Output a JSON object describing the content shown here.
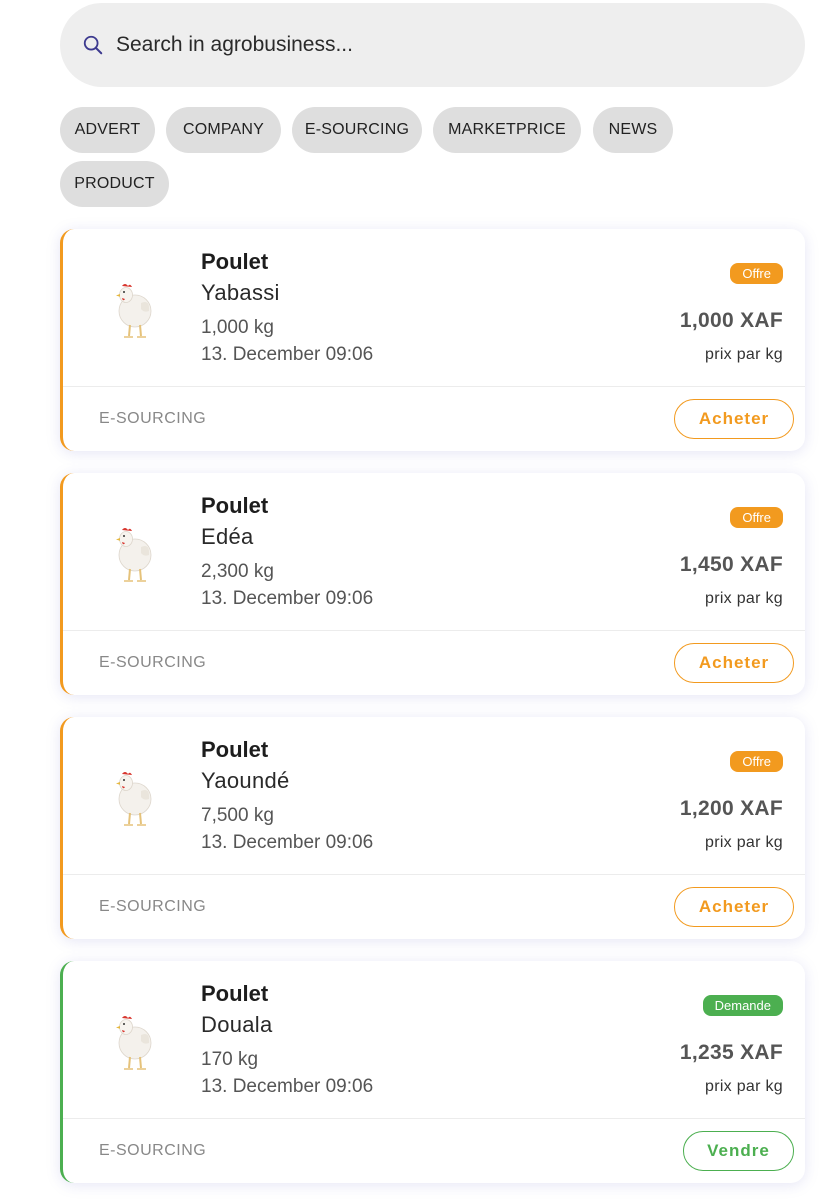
{
  "search": {
    "placeholder": "Search in agrobusiness...",
    "icon": "search-icon",
    "icon_color": "#3d3a8f"
  },
  "filters": [
    "ADVERT",
    "COMPANY",
    "E-SOURCING",
    "MARKETPRICE",
    "NEWS",
    "PRODUCT"
  ],
  "colors": {
    "offre": "#f29a1f",
    "demande": "#4caf50"
  },
  "listings": [
    {
      "product": "Poulet",
      "city": "Yabassi",
      "quantity": "1,000 kg",
      "date": "13. December 09:06",
      "badge": "Offre",
      "price": "1,000 XAF",
      "unit": "prix par kg",
      "category": "E-SOURCING",
      "action": "Acheter",
      "type": "offre",
      "image": "chicken-image"
    },
    {
      "product": "Poulet",
      "city": "Edéa",
      "quantity": "2,300 kg",
      "date": "13. December 09:06",
      "badge": "Offre",
      "price": "1,450 XAF",
      "unit": "prix par kg",
      "category": "E-SOURCING",
      "action": "Acheter",
      "type": "offre",
      "image": "chicken-image"
    },
    {
      "product": "Poulet",
      "city": "Yaoundé",
      "quantity": "7,500 kg",
      "date": "13. December 09:06",
      "badge": "Offre",
      "price": "1,200 XAF",
      "unit": "prix par kg",
      "category": "E-SOURCING",
      "action": "Acheter",
      "type": "offre",
      "image": "chicken-image"
    },
    {
      "product": "Poulet",
      "city": "Douala",
      "quantity": "170 kg",
      "date": "13. December 09:06",
      "badge": "Demande",
      "price": "1,235 XAF",
      "unit": "prix par kg",
      "category": "E-SOURCING",
      "action": "Vendre",
      "type": "demande",
      "image": "chicken-image"
    }
  ]
}
